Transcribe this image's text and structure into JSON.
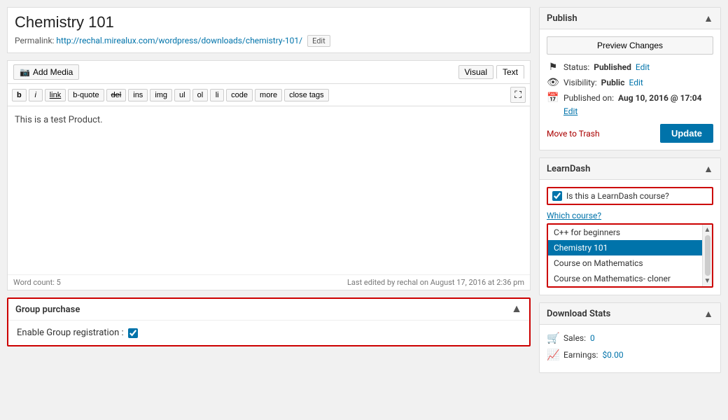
{
  "page": {
    "title": "Chemistry 101"
  },
  "permalink": {
    "label": "Permalink:",
    "url": "http://rechal.mirealux.com/wordpress/downloads/chemistry-101/",
    "edit_label": "Edit"
  },
  "toolbar": {
    "add_media_label": "Add Media",
    "visual_tab": "Visual",
    "text_tab": "Text",
    "buttons": [
      "b",
      "i",
      "link",
      "b-quote",
      "del",
      "ins",
      "img",
      "ul",
      "ol",
      "li",
      "code",
      "more",
      "close tags"
    ]
  },
  "editor": {
    "content": "This is a test Product.",
    "word_count_label": "Word count: 5",
    "last_edited": "Last edited by rechal on August 17, 2016 at 2:36 pm"
  },
  "group_purchase": {
    "title": "Group purchase",
    "enable_label": "Enable Group registration :",
    "checked": true
  },
  "publish": {
    "title": "Publish",
    "preview_label": "Preview Changes",
    "status_label": "Status:",
    "status_value": "Published",
    "status_edit": "Edit",
    "visibility_label": "Visibility:",
    "visibility_value": "Public",
    "visibility_edit": "Edit",
    "published_label": "Published on:",
    "published_value": "Aug 10, 2016 @ 17:04",
    "published_edit": "Edit",
    "move_trash": "Move to Trash",
    "update_label": "Update"
  },
  "learndash": {
    "title": "LearnDash",
    "checkbox_label": "Is this a LearnDash course?",
    "checked": true,
    "which_course_label": "Which course?",
    "courses": [
      {
        "id": 1,
        "name": "C++ for beginners",
        "selected": false
      },
      {
        "id": 2,
        "name": "Chemistry 101",
        "selected": true
      },
      {
        "id": 3,
        "name": "Course on Mathematics",
        "selected": false
      },
      {
        "id": 4,
        "name": "Course on Mathematics- cloner",
        "selected": false
      }
    ]
  },
  "download_stats": {
    "title": "Download Stats",
    "sales_label": "Sales:",
    "sales_value": "0",
    "earnings_label": "Earnings:",
    "earnings_value": "$0.00"
  }
}
